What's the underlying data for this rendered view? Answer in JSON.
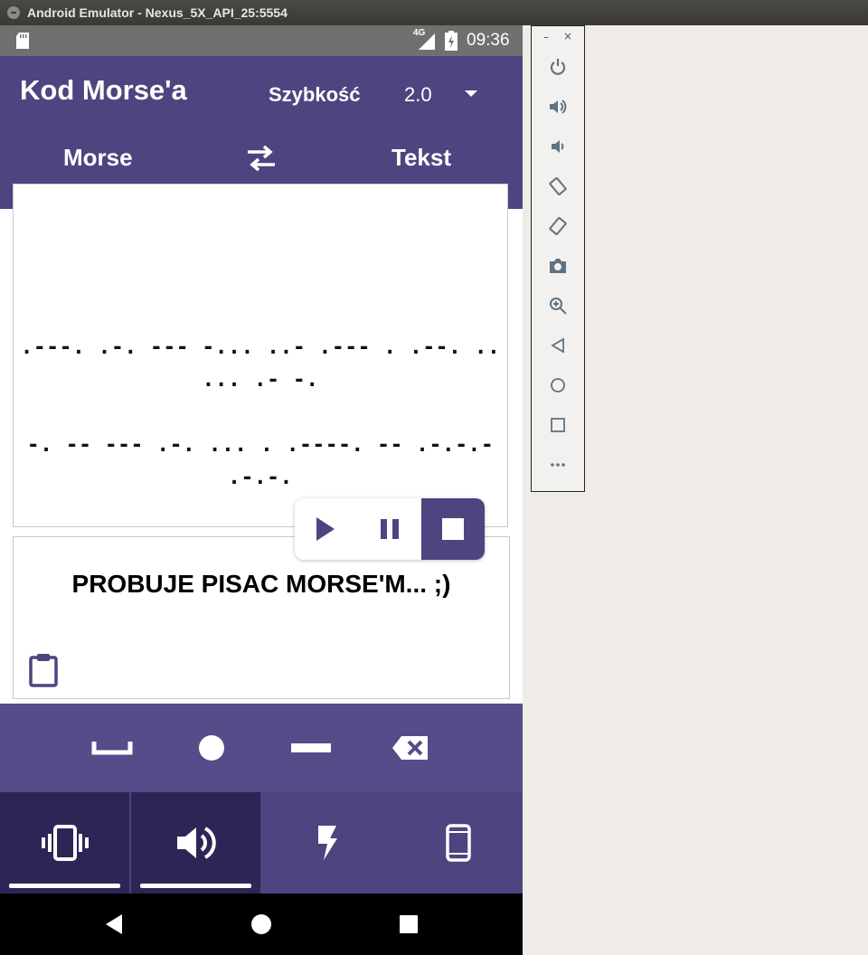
{
  "window": {
    "title": "Android Emulator - Nexus_5X_API_25:5554"
  },
  "statusbar": {
    "network": "4G",
    "time": "09:36"
  },
  "app": {
    "title": "Kod Morse'a",
    "speed_label": "Szybkość",
    "speed_value": "2.0",
    "tab_left": "Morse",
    "tab_right": "Tekst"
  },
  "morse": {
    "text": ".---. .-. --- -... ..- .--- .   .--. .. ... .- -.-.   -- --- .-. ... . .----. -- .-.-.- .-.-.- .-.-.-   -.--.-"
  },
  "morse_display": {
    "line1": ".---. .-. --- -... ..- .--- .   .--. .. ... .- -.",
    "line2": "-.   -- --- .-. ... . .----. -- .-.-.- .-.-.",
    "line3": "- .-.-.-   -.-.-. -.--.-"
  },
  "decoded": {
    "text": "PROBUJE PISAC MORSE'M... ;)"
  },
  "player": {
    "buttons": [
      "play-icon",
      "pause-icon",
      "stop-icon"
    ],
    "accent": "#4d4580"
  },
  "keypad": {
    "keys": [
      "space-key-icon",
      "dot-key-icon",
      "dash-key-icon",
      "backspace-icon"
    ]
  },
  "modes": {
    "items": [
      {
        "icon": "vibrate-icon",
        "active": true
      },
      {
        "icon": "volume-icon",
        "active": true
      },
      {
        "icon": "flash-icon",
        "active": false
      },
      {
        "icon": "screen-icon",
        "active": false
      }
    ]
  },
  "colors": {
    "primary": "#4d4580",
    "primary_dark": "#2c2657",
    "keypad": "#554c8a"
  },
  "side_panel": {
    "buttons": [
      "power-icon",
      "volume-up-icon",
      "volume-down-icon",
      "rotate-left-icon",
      "rotate-right-icon",
      "camera-icon",
      "zoom-icon",
      "back-icon",
      "home-icon",
      "overview-icon",
      "more-icon"
    ]
  }
}
